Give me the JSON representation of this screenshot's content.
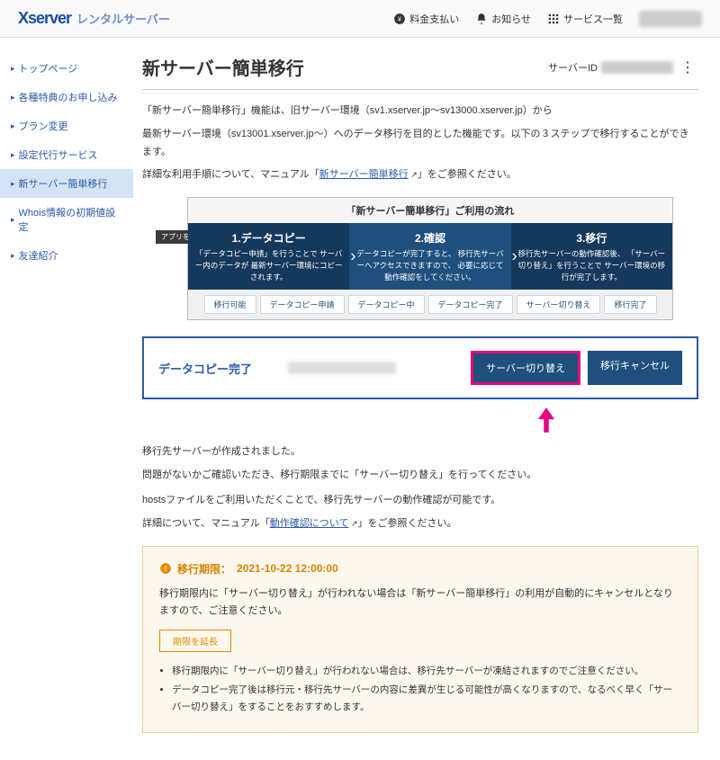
{
  "header": {
    "logo_mark": "Xserver",
    "logo_sub": "レンタルサーバー",
    "items": [
      {
        "label": "料金支払い",
        "icon": "yen-icon"
      },
      {
        "label": "お知らせ",
        "icon": "bell-icon"
      },
      {
        "label": "サービス一覧",
        "icon": "grid-icon"
      }
    ]
  },
  "sidebar": {
    "items": [
      "トップページ",
      "各種特典のお申し込み",
      "プラン変更",
      "設定代行サービス",
      "新サーバー簡単移行",
      "Whois情報の初期値設定",
      "友達紹介"
    ],
    "active_index": 4
  },
  "page": {
    "title": "新サーバー簡単移行",
    "server_id_label": "サーバーID",
    "desc1": "「新サーバー簡単移行」機能は、旧サーバー環境（sv1.xserver.jp～sv13000.xserver.jp）から",
    "desc2": "最新サーバー環境（sv13001.xserver.jp～）へのデータ移行を目的とした機能です。以下の３ステップで移行することができます。",
    "desc3_pre": "詳細な利用手順について、マニュアル「",
    "desc3_link": "新サーバー簡単移行",
    "desc3_post": "」をご参照ください。",
    "app_label": "アプリを表示"
  },
  "flow": {
    "title": "「新サーバー簡単移行」ご利用の流れ",
    "steps": [
      {
        "num": "1.データコピー",
        "desc": "「データコピー申請」を行うことで\nサーバー内のデータが\n最新サーバー環境にコピーされます。"
      },
      {
        "num": "2.確認",
        "desc": "データコピーが完了すると、\n移行先サーバーへアクセスできますので、\n必要に応じて動作確認をしてください。"
      },
      {
        "num": "3.移行",
        "desc": "移行先サーバーの動作確認後、\n「サーバー切り替え」を行うことで\nサーバー環境の移行が完了します。"
      }
    ],
    "tags": [
      "移行可能",
      "データコピー申請",
      "データコピー中",
      "データコピー完了",
      "サーバー切り替え",
      "移行完了"
    ]
  },
  "status": {
    "label": "データコピー完了",
    "btn_primary": "サーバー切り替え",
    "btn_secondary": "移行キャンセル"
  },
  "guide": {
    "line1": "移行先サーバーが作成されました。",
    "line2": "問題がないかご確認いただき、移行期限までに「サーバー切り替え」を行ってください。",
    "line3": "hostsファイルをご利用いただくことで、移行先サーバーの動作確認が可能です。",
    "line4_pre": "詳細について、マニュアル「",
    "line4_link": "動作確認について",
    "line4_post": "」をご参照ください。"
  },
  "notice": {
    "title_label": "移行期限：",
    "deadline": "2021-10-22 12:00:00",
    "body": "移行期限内に「サーバー切り替え」が行われない場合は「新サーバー簡単移行」の利用が自動的にキャンセルとなりますので、ご注意ください。",
    "extend_btn": "期限を延長",
    "bullets": [
      "移行期限内に「サーバー切り替え」が行われない場合は、移行先サーバーが凍結されますのでご注意ください。",
      "データコピー完了後は移行元・移行先サーバーの内容に差異が生じる可能性が高くなりますので、なるべく早く「サーバー切り替え」をすることをおすすめします。"
    ]
  }
}
